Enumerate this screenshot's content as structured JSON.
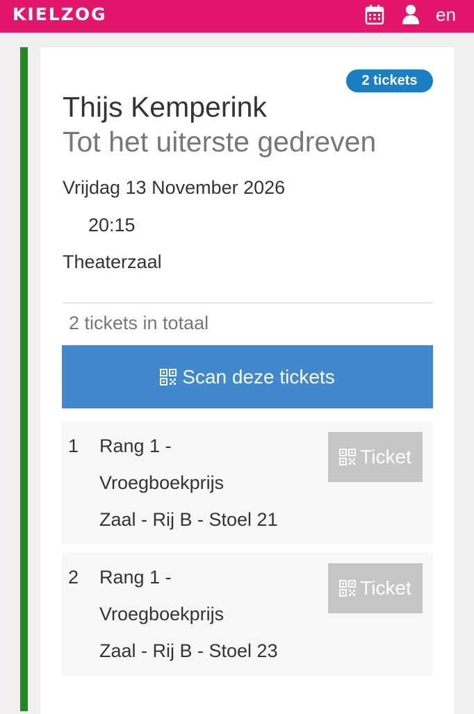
{
  "header": {
    "brand": "KIELZOG",
    "language": "en",
    "icons": [
      "calendar-icon",
      "user-icon"
    ],
    "background_color": "#e4166c"
  },
  "event": {
    "badge": "2 tickets",
    "artist": "Thijs Kemperink",
    "title": "Tot het uiterste gedreven",
    "date": "Vrijdag 13 November 2026",
    "time": "20:15",
    "venue": "Theaterzaal",
    "total": "2 tickets in totaal",
    "scan_label": "Scan deze tickets",
    "status_color": "#1e8c23"
  },
  "tickets": [
    {
      "number": "1",
      "line1": "Rang 1 -",
      "line2": "Vroegboekprijs",
      "line3": "Zaal - Rij B - Stoel 21",
      "button_label": "Ticket"
    },
    {
      "number": "2",
      "line1": "Rang 1 -",
      "line2": "Vroegboekprijs",
      "line3": "Zaal - Rij B - Stoel 23",
      "button_label": "Ticket"
    }
  ]
}
